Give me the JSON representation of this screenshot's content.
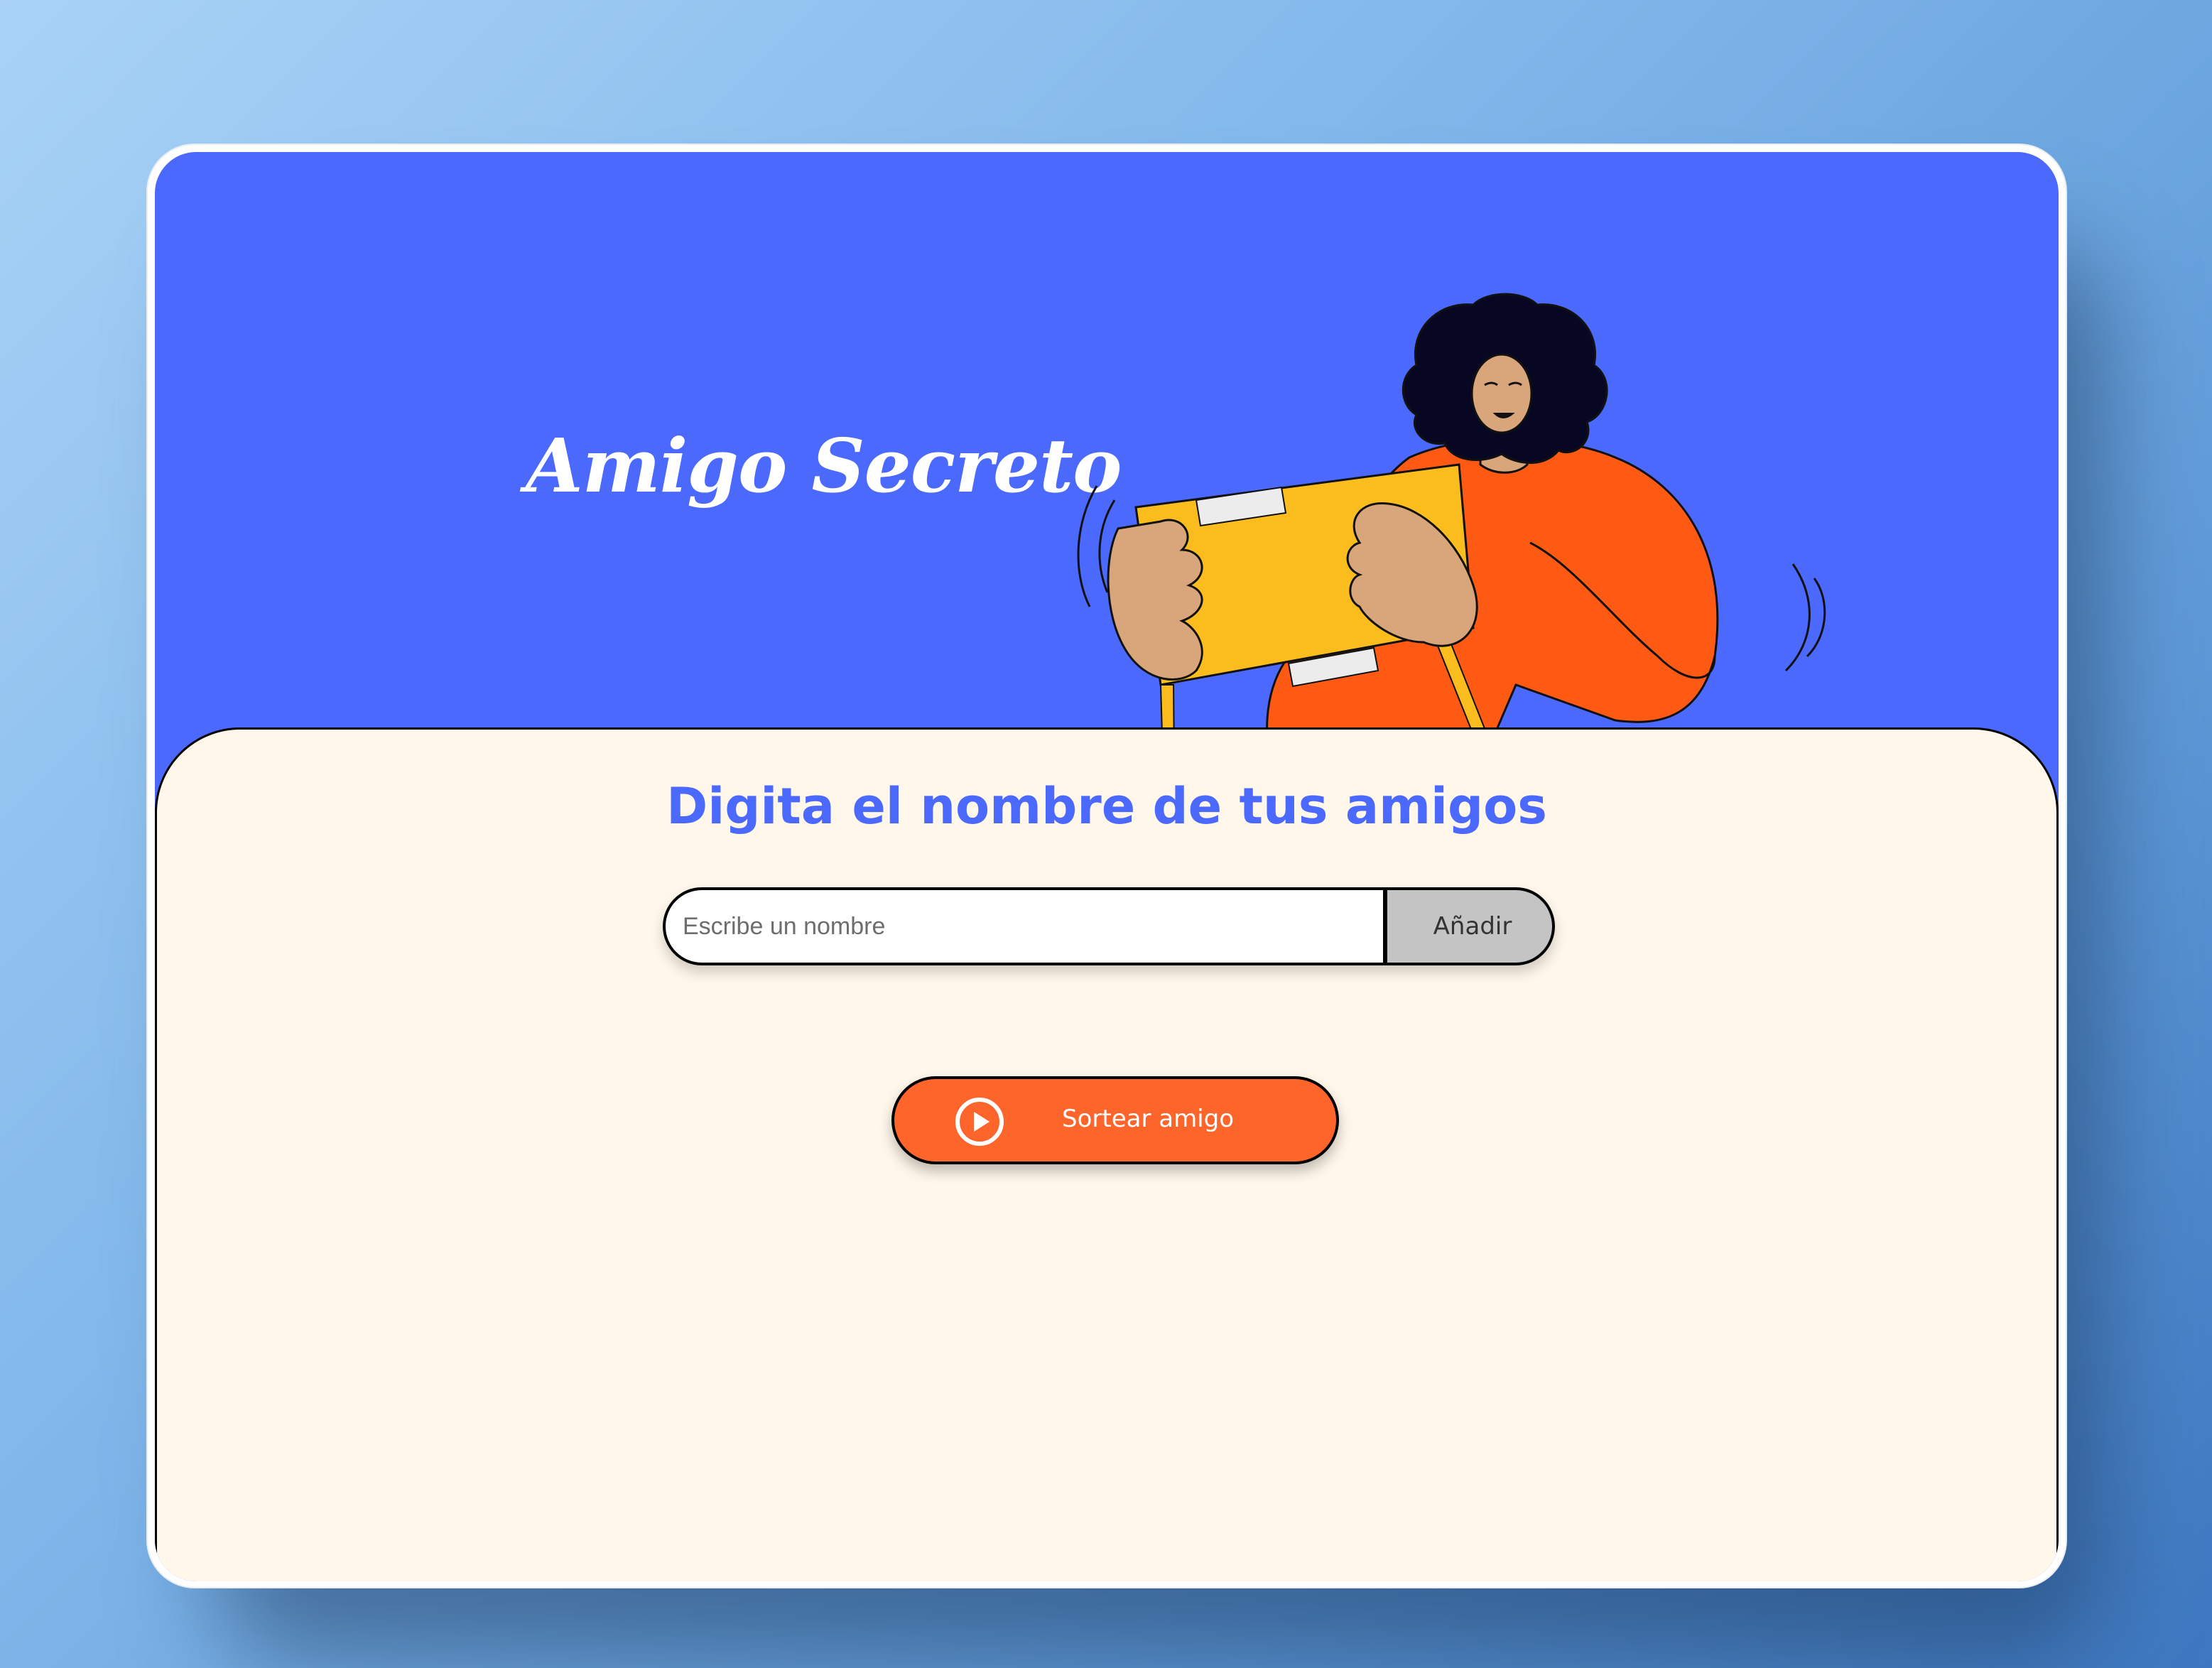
{
  "app": {
    "title": "Amigo Secreto",
    "illustration_icon": "person-opening-gift-illustration"
  },
  "main": {
    "subtitle": "Digita el nombre de tus amigos",
    "name_input": {
      "placeholder": "Escribe un nombre",
      "value": ""
    },
    "add_button_label": "Añadir",
    "draw_button": {
      "label": "Sortear amigo",
      "icon": "play-circle-icon"
    }
  },
  "colors": {
    "header_background": "#4b69fd",
    "content_background": "#fff7ea",
    "accent_orange": "#fe652b",
    "add_button_gray": "#c4c4c4",
    "subtitle_blue": "#4b69fd"
  }
}
